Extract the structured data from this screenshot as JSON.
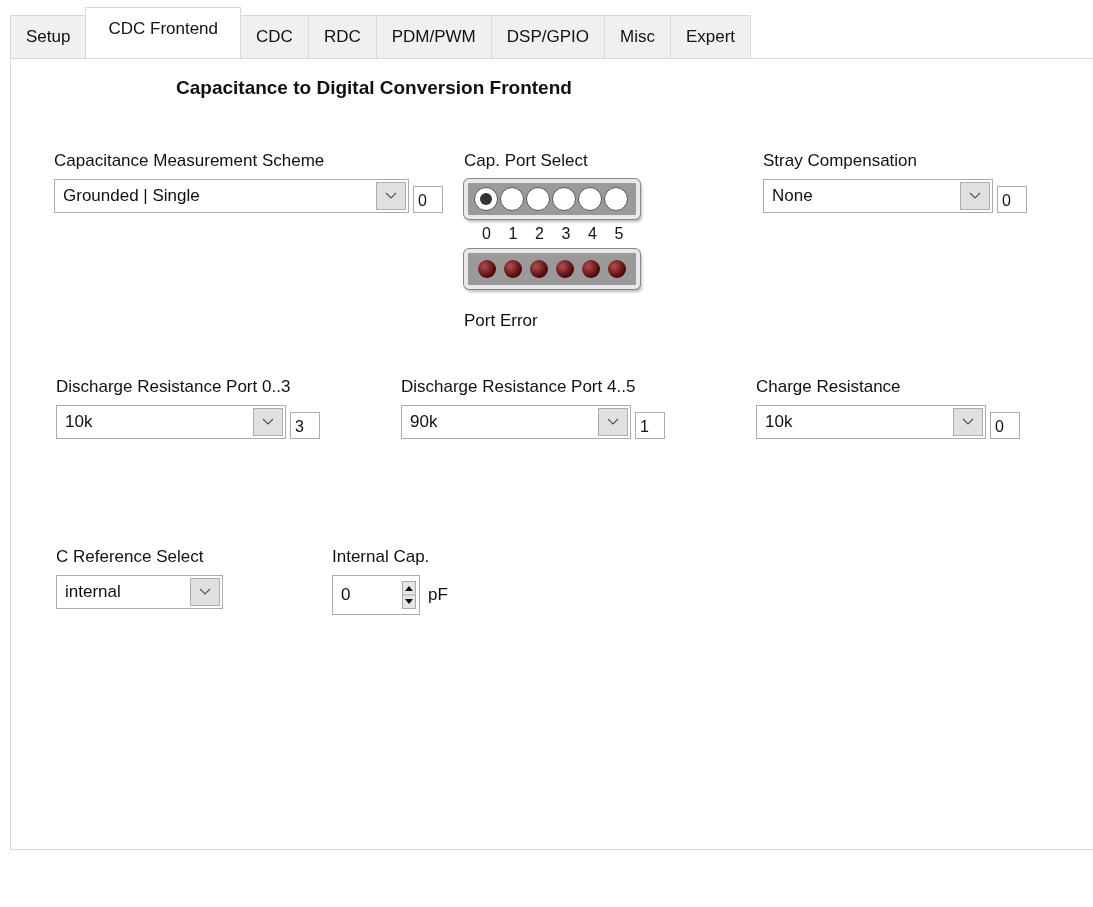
{
  "tabs": [
    {
      "label": "Setup",
      "selected": false
    },
    {
      "label": "CDC Frontend",
      "selected": true
    },
    {
      "label": "CDC",
      "selected": false
    },
    {
      "label": "RDC",
      "selected": false
    },
    {
      "label": "PDM/PWM",
      "selected": false
    },
    {
      "label": "DSP/GPIO",
      "selected": false
    },
    {
      "label": "Misc",
      "selected": false
    },
    {
      "label": "Expert",
      "selected": false
    }
  ],
  "title": "Capacitance to Digital Conversion Frontend",
  "measurement_scheme": {
    "label": "Capacitance Measurement Scheme",
    "value": "Grounded | Single",
    "code": "0"
  },
  "cap_port_select": {
    "label": "Cap. Port Select",
    "ports": [
      {
        "label": "0",
        "selected": true
      },
      {
        "label": "1",
        "selected": false
      },
      {
        "label": "2",
        "selected": false
      },
      {
        "label": "3",
        "selected": false
      },
      {
        "label": "4",
        "selected": false
      },
      {
        "label": "5",
        "selected": false
      }
    ],
    "error_leds": [
      {
        "on": false
      },
      {
        "on": false
      },
      {
        "on": false
      },
      {
        "on": false
      },
      {
        "on": false
      },
      {
        "on": false
      }
    ],
    "error_label": "Port Error"
  },
  "stray_compensation": {
    "label": "Stray Compensation",
    "value": "None",
    "code": "0"
  },
  "resistances": [
    {
      "label": "Discharge Resistance Port 0..3",
      "value": "10k",
      "code": "3"
    },
    {
      "label": "Discharge Resistance Port 4..5",
      "value": "90k",
      "code": "1"
    },
    {
      "label": "Charge Resistance",
      "value": "10k",
      "code": "0"
    }
  ],
  "c_reference": {
    "label": "C Reference Select",
    "value": "internal"
  },
  "internal_cap": {
    "label": "Internal Cap.",
    "value": "0",
    "unit": "pF"
  }
}
